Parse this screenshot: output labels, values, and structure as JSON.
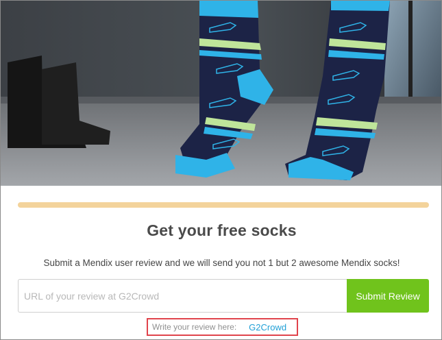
{
  "hero": {
    "image_alt": "Mendix rocket socks photo"
  },
  "progress": {
    "fraction": 1.0
  },
  "main": {
    "title": "Get your free socks",
    "subtitle": "Submit a Mendix user review and we will send you not 1 but 2 awesome Mendix socks!"
  },
  "form": {
    "url_value": "",
    "url_placeholder": "URL of your review at G2Crowd",
    "submit_label": "Submit Review"
  },
  "review_hint": {
    "label": "Write your review here:",
    "link_label": "G2Crowd"
  },
  "colors": {
    "button_green": "#70c31c",
    "link_blue": "#1f9fd6",
    "highlight_red": "#e0434b",
    "progress_bar": "#f3d39b",
    "sock_navy": "#1c2346",
    "sock_cyan": "#2fb3e8"
  }
}
